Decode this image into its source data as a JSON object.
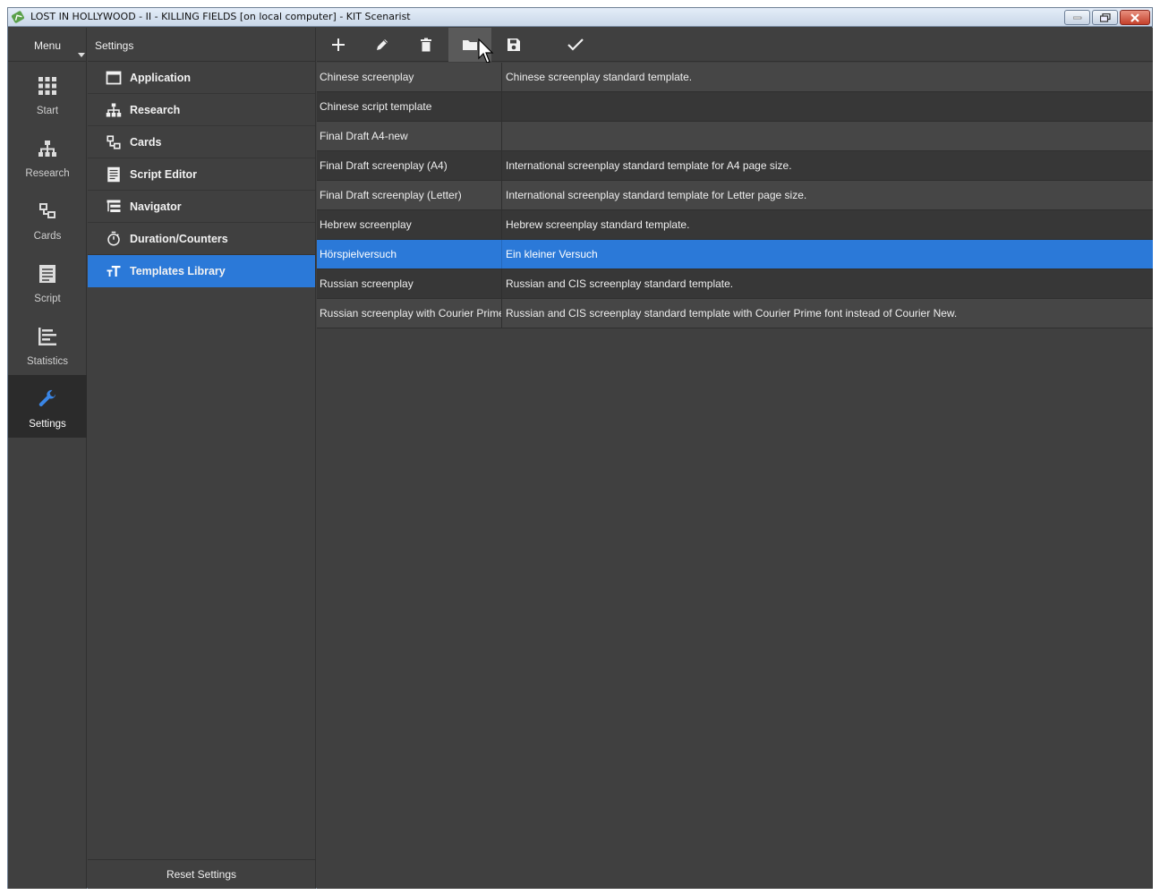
{
  "window": {
    "title": "LOST IN HOLLYWOOD - II - KILLING FIELDS [on local computer] - KIT Scenarist"
  },
  "nav": {
    "menu_label": "Menu",
    "items": [
      {
        "label": "Start",
        "icon": "grid-icon"
      },
      {
        "label": "Research",
        "icon": "hierarchy-icon"
      },
      {
        "label": "Cards",
        "icon": "cards-icon"
      },
      {
        "label": "Script",
        "icon": "document-icon"
      },
      {
        "label": "Statistics",
        "icon": "bar-list-icon"
      },
      {
        "label": "Settings",
        "icon": "wrench-icon",
        "active": true
      }
    ]
  },
  "settings": {
    "title": "Settings",
    "items": [
      {
        "label": "Application",
        "icon": "window-icon"
      },
      {
        "label": "Research",
        "icon": "hierarchy-icon"
      },
      {
        "label": "Cards",
        "icon": "cards-icon"
      },
      {
        "label": "Script Editor",
        "icon": "document-icon"
      },
      {
        "label": "Navigator",
        "icon": "tree-list-icon"
      },
      {
        "label": "Duration/Counters",
        "icon": "stopwatch-icon"
      },
      {
        "label": "Templates Library",
        "icon": "text-size-icon",
        "active": true
      }
    ],
    "reset_label": "Reset Settings"
  },
  "toolbar": {
    "buttons": [
      "add-icon",
      "edit-icon",
      "delete-icon",
      "folder-icon",
      "save-icon",
      "check-icon"
    ],
    "hovered": "folder-icon"
  },
  "templates": [
    {
      "name": "Chinese screenplay",
      "description": "Chinese screenplay standard template."
    },
    {
      "name": "Chinese script template",
      "description": ""
    },
    {
      "name": "Final Draft A4-new",
      "description": ""
    },
    {
      "name": "Final Draft screenplay (A4)",
      "description": "International screenplay standard template for A4 page size."
    },
    {
      "name": "Final Draft screenplay (Letter)",
      "description": "International screenplay standard template for Letter page size."
    },
    {
      "name": "Hebrew screenplay",
      "description": "Hebrew screenplay standard template."
    },
    {
      "name": "Hörspielversuch",
      "description": "Ein kleiner Versuch",
      "selected": true
    },
    {
      "name": "Russian screenplay",
      "description": "Russian and CIS screenplay standard template."
    },
    {
      "name": "Russian screenplay with Courier Prime",
      "description": "Russian and CIS screenplay standard template with Courier Prime font instead of Courier New."
    }
  ],
  "colors": {
    "accent": "#2b79d8",
    "background": "#404040",
    "row_alt": "#373737"
  }
}
